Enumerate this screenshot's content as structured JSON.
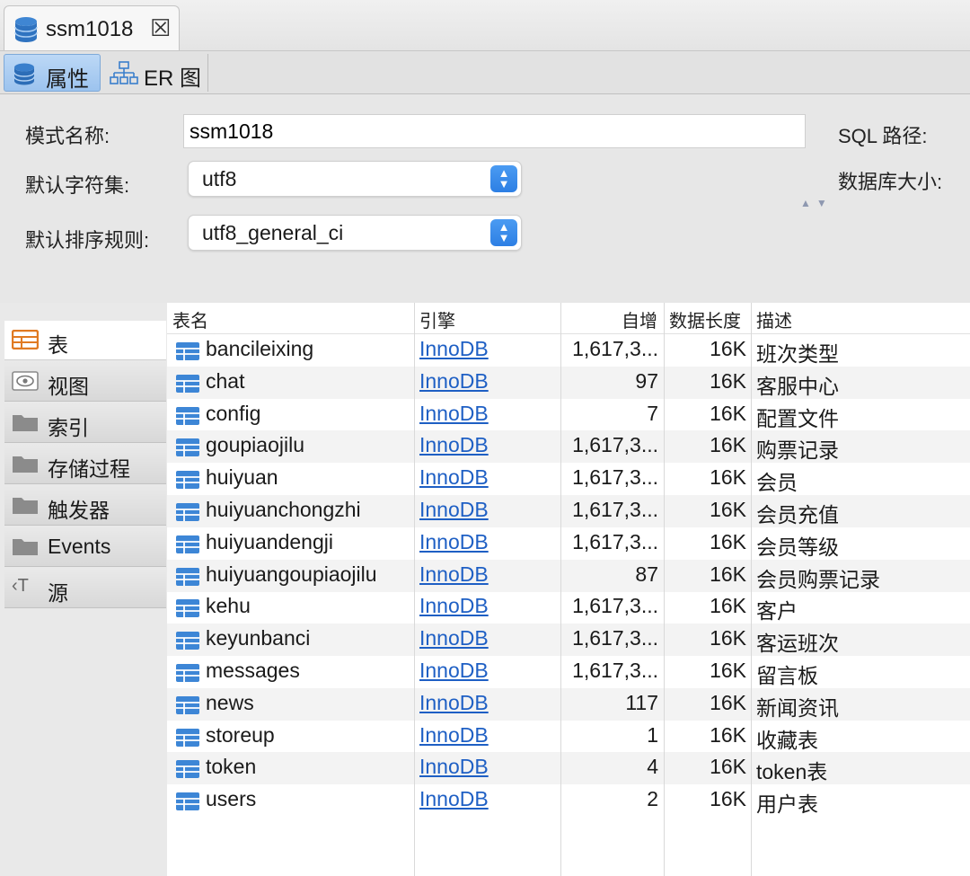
{
  "window": {
    "tab_title": "ssm1018",
    "tab_close": "☒"
  },
  "subtabs": [
    {
      "label": "属性",
      "active": true
    },
    {
      "label": "ER 图",
      "active": false
    }
  ],
  "form": {
    "schema_name_label": "模式名称:",
    "schema_name_value": "ssm1018",
    "charset_label": "默认字符集:",
    "charset_value": "utf8",
    "collation_label": "默认排序规则:",
    "collation_value": "utf8_general_ci",
    "sql_path_label": "SQL 路径:",
    "db_size_label": "数据库大小:"
  },
  "nav": [
    {
      "label": "表",
      "icon": "table-icon",
      "active": true
    },
    {
      "label": "视图",
      "icon": "eye-icon",
      "active": false
    },
    {
      "label": "索引",
      "icon": "folder-icon",
      "active": false
    },
    {
      "label": "存储过程",
      "icon": "folder-icon",
      "active": false
    },
    {
      "label": "触发器",
      "icon": "folder-icon",
      "active": false
    },
    {
      "label": "Events",
      "icon": "folder-icon",
      "active": false
    },
    {
      "label": "源",
      "icon": "source-icon",
      "active": false
    }
  ],
  "table": {
    "columns": [
      "表名",
      "引擎",
      "自增",
      "数据长度",
      "描述"
    ],
    "rows": [
      {
        "name": "bancileixing",
        "engine": "InnoDB",
        "auto_increment": "1,617,3...",
        "data_length": "16K",
        "comment": "班次类型"
      },
      {
        "name": "chat",
        "engine": "InnoDB",
        "auto_increment": "97",
        "data_length": "16K",
        "comment": "客服中心"
      },
      {
        "name": "config",
        "engine": "InnoDB",
        "auto_increment": "7",
        "data_length": "16K",
        "comment": "配置文件"
      },
      {
        "name": "goupiaojilu",
        "engine": "InnoDB",
        "auto_increment": "1,617,3...",
        "data_length": "16K",
        "comment": "购票记录"
      },
      {
        "name": "huiyuan",
        "engine": "InnoDB",
        "auto_increment": "1,617,3...",
        "data_length": "16K",
        "comment": "会员"
      },
      {
        "name": "huiyuanchongzhi",
        "engine": "InnoDB",
        "auto_increment": "1,617,3...",
        "data_length": "16K",
        "comment": "会员充值"
      },
      {
        "name": "huiyuandengji",
        "engine": "InnoDB",
        "auto_increment": "1,617,3...",
        "data_length": "16K",
        "comment": "会员等级"
      },
      {
        "name": "huiyuangoupiaojilu",
        "engine": "InnoDB",
        "auto_increment": "87",
        "data_length": "16K",
        "comment": "会员购票记录"
      },
      {
        "name": "kehu",
        "engine": "InnoDB",
        "auto_increment": "1,617,3...",
        "data_length": "16K",
        "comment": "客户"
      },
      {
        "name": "keyunbanci",
        "engine": "InnoDB",
        "auto_increment": "1,617,3...",
        "data_length": "16K",
        "comment": "客运班次"
      },
      {
        "name": "messages",
        "engine": "InnoDB",
        "auto_increment": "1,617,3...",
        "data_length": "16K",
        "comment": "留言板"
      },
      {
        "name": "news",
        "engine": "InnoDB",
        "auto_increment": "117",
        "data_length": "16K",
        "comment": "新闻资讯"
      },
      {
        "name": "storeup",
        "engine": "InnoDB",
        "auto_increment": "1",
        "data_length": "16K",
        "comment": "收藏表"
      },
      {
        "name": "token",
        "engine": "InnoDB",
        "auto_increment": "4",
        "data_length": "16K",
        "comment": "token表"
      },
      {
        "name": "users",
        "engine": "InnoDB",
        "auto_increment": "2",
        "data_length": "16K",
        "comment": "用户表"
      }
    ]
  },
  "colors": {
    "link": "#1e5fc4",
    "accent": "#2d7fe4",
    "table_icon": "#3d86d6",
    "active_tab": "#9cc3ee"
  }
}
